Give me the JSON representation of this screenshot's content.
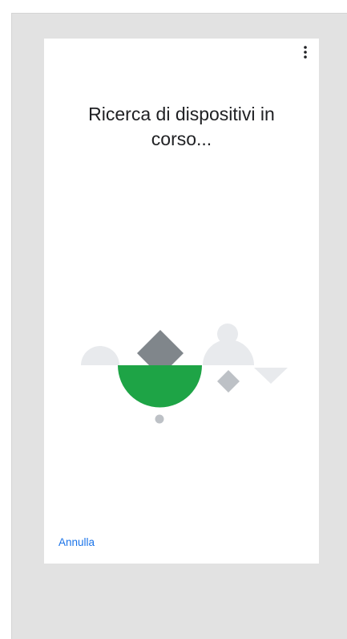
{
  "dialog": {
    "title": "Ricerca di dispositivi in corso...",
    "cancel_label": "Annulla",
    "menu_icon": "more-vert-icon"
  },
  "colors": {
    "accent": "#1a73e8",
    "green": "#1ea446",
    "gray_dark": "#80868b",
    "gray_mid": "#bdc1c6",
    "gray_light": "#e8eaed"
  }
}
